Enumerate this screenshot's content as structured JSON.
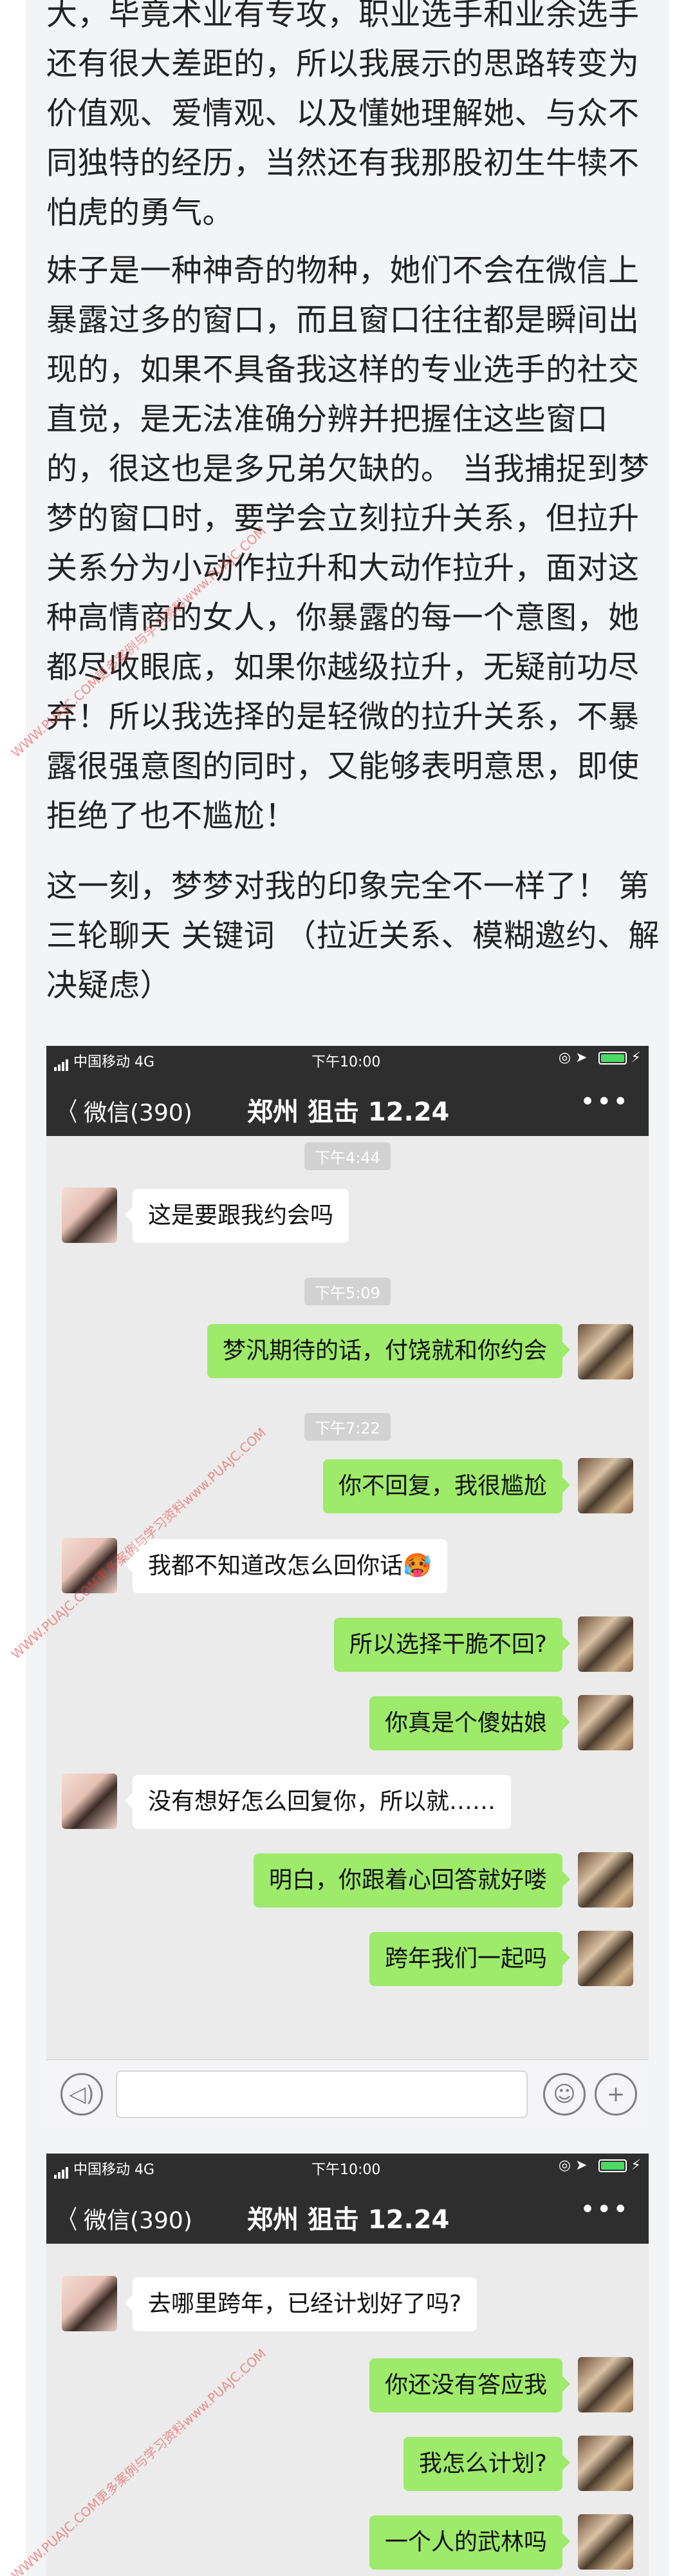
{
  "article": {
    "para1": [
      "大，毕竟术业有专攻，职业选手和业余选手",
      "还有很大差距的，所以我展示的思路转变为",
      "价值观、爱情观、以及懂她理解她、与众不",
      "同独特的经历，当然还有我那股初生牛犊不",
      "怕虎的勇气。"
    ],
    "para2": [
      "妹子是一种神奇的物种，她们不会在微信上",
      "暴露过多的窗口，而且窗口往往都是瞬间出",
      "现的，如果不具备我这样的专业选手的社交",
      "直觉，是无法准确分辨并把握住这些窗口",
      "的，很这也是多兄弟欠缺的。 当我捕捉到梦",
      "梦的窗口时，要学会立刻拉升关系，但拉升",
      "关系分为小动作拉升和大动作拉升，面对这",
      "种高情商的女人，你暴露的每一个意图，她",
      "都尽收眼底，如果你越级拉升，无疑前功尽",
      "弃！所以我选择的是轻微的拉升关系，不暴",
      "露很强意图的同时，又能够表明意思，即使",
      "拒绝了也不尴尬！"
    ],
    "para3": [
      "这一刻，梦梦对我的印象完全不一样了！ 第",
      "三轮聊天 关键词 （拉近关系、模糊邀约、解",
      "决疑虑）"
    ]
  },
  "screenshot1": {
    "status": {
      "carrier": "中国移动 4G",
      "time": "下午10:00"
    },
    "nav": {
      "back_label": "微信(390)",
      "title": "郑州 狙击 12.24",
      "more": "•••"
    },
    "messages": [
      {
        "type": "time",
        "text": "下午4:44"
      },
      {
        "type": "her",
        "text": "这是要跟我约会吗"
      },
      {
        "type": "time",
        "text": "下午5:09"
      },
      {
        "type": "me",
        "text": "梦汎期待的话，付饶就和你约会"
      },
      {
        "type": "time",
        "text": "下午7:22"
      },
      {
        "type": "me",
        "text": "你不回复，我很尴尬"
      },
      {
        "type": "her",
        "text": "我都不知道改怎么回你话🥵"
      },
      {
        "type": "me",
        "text": "所以选择干脆不回?"
      },
      {
        "type": "me",
        "text": "你真是个傻姑娘"
      },
      {
        "type": "her",
        "text": "没有想好怎么回复你，所以就……"
      },
      {
        "type": "me",
        "text": "明白，你跟着心回答就好喽"
      },
      {
        "type": "me",
        "text": "跨年我们一起吗"
      }
    ]
  },
  "screenshot2": {
    "status": {
      "carrier": "中国移动 4G",
      "time": "下午10:00"
    },
    "nav": {
      "back_label": "微信(390)",
      "title": "郑州 狙击 12.24",
      "more": "•••"
    },
    "messages": [
      {
        "type": "her",
        "text": "去哪里跨年，已经计划好了吗?"
      },
      {
        "type": "me",
        "text": "你还没有答应我"
      },
      {
        "type": "me",
        "text": "我怎么计划?"
      },
      {
        "type": "me",
        "text": "一个人的武林吗"
      }
    ]
  },
  "watermark": "WWW.PUAJC.COM更多案例与学习资料www.PUAJC.COM",
  "colors": {
    "accent_green": "#9eea6a",
    "nav_dark": "#2e2e2e",
    "chat_bg": "#ebebeb"
  },
  "icons": {
    "voice": "voice-icon",
    "emoji": "emoji-icon",
    "add": "add-icon",
    "back": "chevron-left-icon"
  }
}
